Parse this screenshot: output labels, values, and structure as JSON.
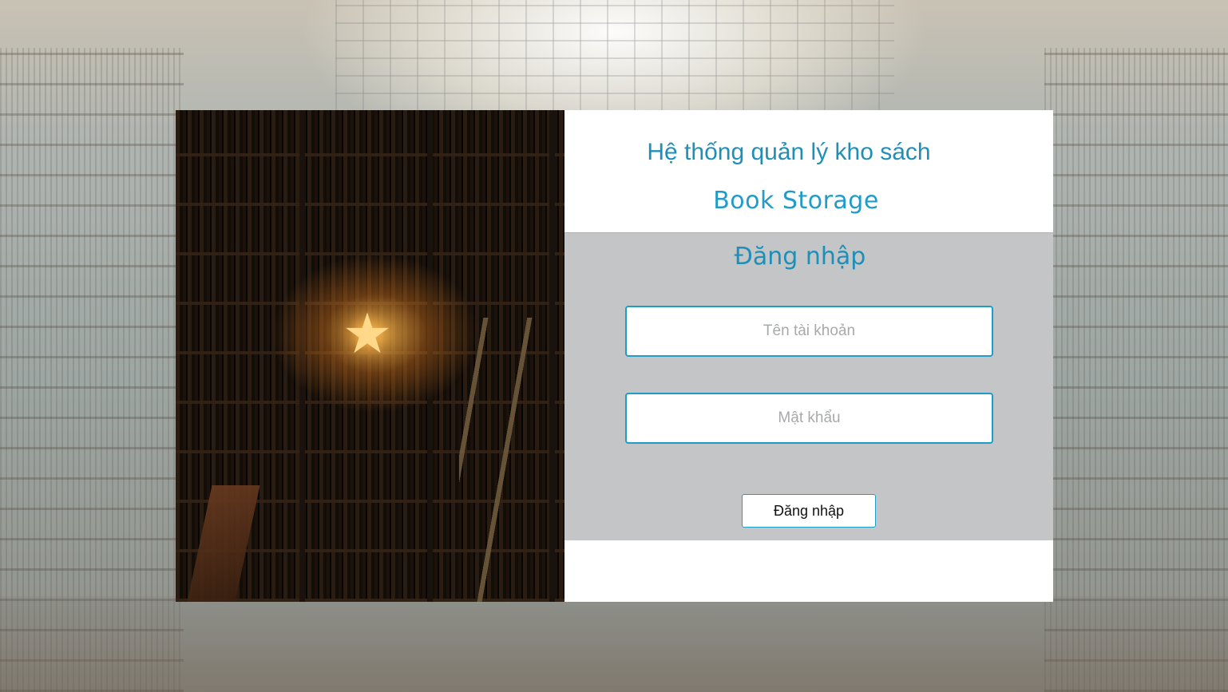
{
  "header": {
    "title": "Hệ thống quản lý kho sách",
    "subtitle": "Book Storage"
  },
  "login": {
    "heading": "Đăng nhập",
    "username_placeholder": "Tên tài khoản",
    "username_value": "",
    "password_placeholder": "Mật khẩu",
    "password_value": "",
    "submit_label": "Đăng nhập"
  },
  "colors": {
    "accent": "#1f9cc7",
    "form_background": "#c3c5c7",
    "panel_background": "#ffffff"
  },
  "icons": {
    "photo_star": "star-lamp-icon"
  }
}
